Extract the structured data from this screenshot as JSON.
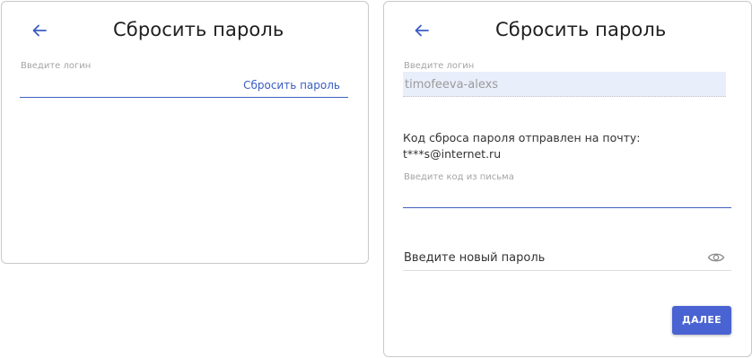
{
  "left_panel": {
    "title": "Сбросить пароль",
    "login_label": "Введите логин",
    "reset_link": "Сбросить пароль"
  },
  "right_panel": {
    "title": "Сбросить пароль",
    "login_label": "Введите логин",
    "login_value": "timofeeva-alexs",
    "info_line1": "Код сброса пароля отправлен на почту:",
    "info_line2": "t***s@internet.ru",
    "code_label": "Введите код из письма",
    "new_password_placeholder": "Введите новый пароль",
    "submit_label": "ДАЛЕЕ"
  },
  "icons": {
    "back": "arrow-left-icon",
    "show_password": "eye-icon"
  },
  "colors": {
    "accent": "#3a5cc4",
    "button": "#4a63d2",
    "filled_field_bg": "#e9eefb"
  }
}
